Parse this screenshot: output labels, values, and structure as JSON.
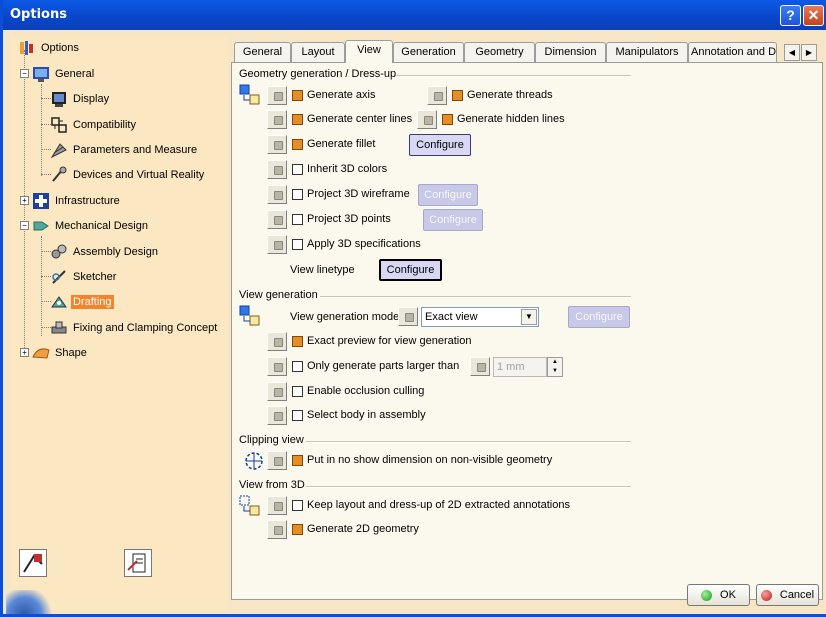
{
  "window": {
    "title": "Options",
    "help_label": "?",
    "close_label": "✕"
  },
  "tree": {
    "items": [
      {
        "label": "Options"
      },
      {
        "label": "General"
      },
      {
        "label": "Display"
      },
      {
        "label": "Compatibility"
      },
      {
        "label": "Parameters and Measure"
      },
      {
        "label": "Devices and Virtual Reality"
      },
      {
        "label": "Infrastructure"
      },
      {
        "label": "Mechanical Design"
      },
      {
        "label": "Assembly Design"
      },
      {
        "label": "Sketcher"
      },
      {
        "label": "Drafting"
      },
      {
        "label": "Fixing and Clamping Concept"
      },
      {
        "label": "Shape"
      }
    ],
    "selected": "Drafting"
  },
  "tabs": [
    {
      "label": "General"
    },
    {
      "label": "Layout"
    },
    {
      "label": "View"
    },
    {
      "label": "Generation"
    },
    {
      "label": "Geometry"
    },
    {
      "label": "Dimension"
    },
    {
      "label": "Manipulators"
    },
    {
      "label": "Annotation and D"
    }
  ],
  "active_tab": "View",
  "sections": {
    "geometry": {
      "title": "Geometry generation / Dress-up",
      "generate_axis": "Generate axis",
      "generate_threads": "Generate threads",
      "generate_center_lines": "Generate center lines",
      "generate_hidden_lines": "Generate hidden lines",
      "generate_fillet": "Generate fillet",
      "inherit_3d_colors": "Inherit 3D colors",
      "project_3d_wireframe": "Project 3D wireframe",
      "project_3d_points": "Project 3D points",
      "apply_3d_specs": "Apply 3D specifications",
      "view_linetype": "View linetype"
    },
    "view_generation": {
      "title": "View generation",
      "mode_label": "View generation mode",
      "mode_value": "Exact view",
      "exact_preview": "Exact preview for view generation",
      "only_larger": "Only generate parts larger than",
      "size_value": "1 mm",
      "occlusion": "Enable occlusion culling",
      "select_body": "Select body in assembly"
    },
    "clipping": {
      "title": "Clipping view",
      "no_show": "Put in no show dimension on non-visible geometry"
    },
    "view_from_3d": {
      "title": "View from 3D",
      "keep_layout": "Keep layout and dress-up of 2D extracted annotations",
      "generate_2d": "Generate 2D geometry"
    }
  },
  "configure_label": "Configure",
  "buttons": {
    "ok": "OK",
    "cancel": "Cancel"
  },
  "colors": {
    "accent": "#f4842c",
    "titlebar": "#0a4fd6",
    "panel": "#f7e6c5"
  }
}
